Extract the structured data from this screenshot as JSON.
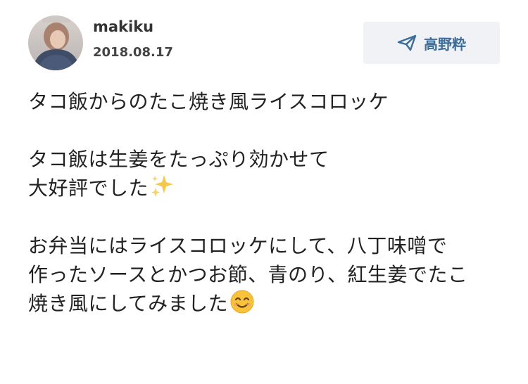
{
  "post": {
    "author": "makiku",
    "date": "2018.08.17",
    "send_button_label": "高野粋",
    "lines": [
      "タコ飯からのたこ焼き風ライスコロッケ",
      "",
      "タコ飯は生姜をたっぷり効かせて",
      "大好評でした",
      "",
      "お弁当にはライスコロッケにして、八丁味噌で",
      "作ったソースとかつお節、青のり、紅生姜でたこ",
      "焼き風にしてみました"
    ]
  },
  "icons": {
    "send_icon": "paper-plane-icon",
    "sparkle_emoji": "sparkles-emoji",
    "smile_emoji": "smiling-face-emoji"
  },
  "colors": {
    "accent": "#3b6c9a",
    "button_bg": "#f0f2f6"
  }
}
